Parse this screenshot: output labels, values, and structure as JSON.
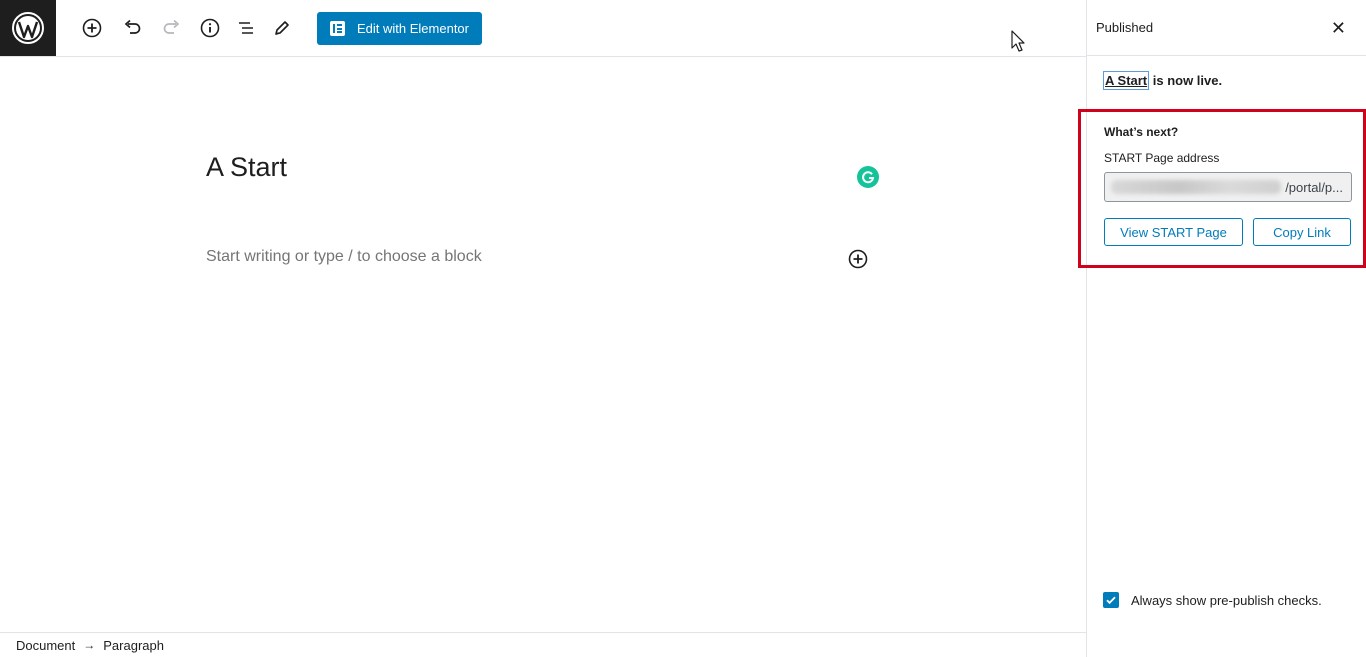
{
  "toolbar": {
    "elementor_label": "Edit with Elementor"
  },
  "editor": {
    "post_title": "A Start",
    "block_placeholder": "Start writing or type / to choose a block"
  },
  "breadcrumb": {
    "items": [
      "Document",
      "Paragraph"
    ],
    "separator": "→"
  },
  "sidebar": {
    "header_title": "Published",
    "close_glyph": "✕",
    "live_link": "A Start",
    "live_suffix": " is now live.",
    "whats_next": "What’s next?",
    "address_label": "START Page address",
    "address_value": "/portal/p...",
    "view_button": "View START Page",
    "copy_button": "Copy Link",
    "checkbox_label": "Always show pre-publish checks.",
    "checkbox_checked": true
  },
  "colors": {
    "accent": "#007cba",
    "highlight_box": "#d0021b",
    "grammarly": "#15c39a",
    "logo_bg": "#1e1e1e"
  }
}
